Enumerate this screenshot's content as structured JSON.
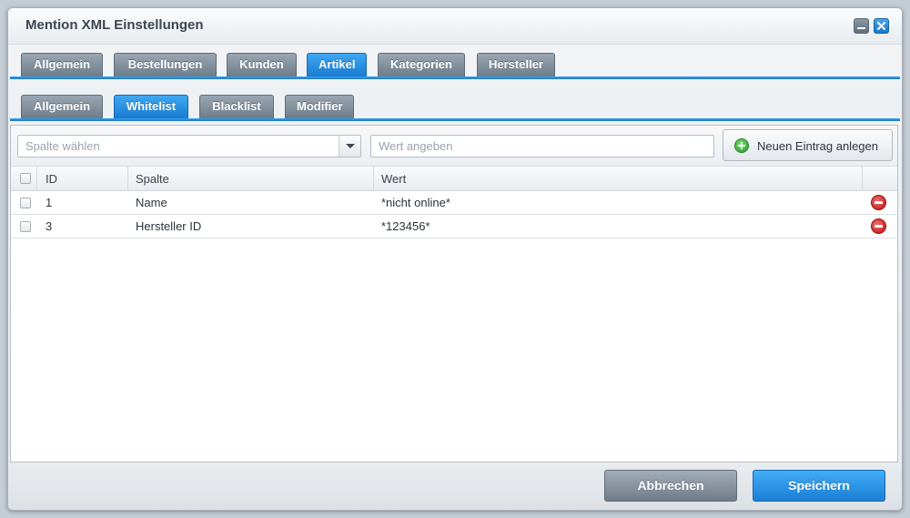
{
  "window": {
    "title": "Mention XML Einstellungen"
  },
  "main_tabs": [
    {
      "label": "Allgemein",
      "active": false
    },
    {
      "label": "Bestellungen",
      "active": false
    },
    {
      "label": "Kunden",
      "active": false
    },
    {
      "label": "Artikel",
      "active": true
    },
    {
      "label": "Kategorien",
      "active": false
    },
    {
      "label": "Hersteller",
      "active": false
    }
  ],
  "sub_tabs": [
    {
      "label": "Allgemein",
      "active": false
    },
    {
      "label": "Whitelist",
      "active": true
    },
    {
      "label": "Blacklist",
      "active": false
    },
    {
      "label": "Modifier",
      "active": false
    }
  ],
  "filter": {
    "column_placeholder": "Spalte wählen",
    "value_placeholder": "Wert angeben",
    "add_button_label": "Neuen Eintrag anlegen"
  },
  "grid": {
    "columns": [
      "ID",
      "Spalte",
      "Wert"
    ],
    "rows": [
      {
        "id": "1",
        "spalte": "Name",
        "wert": "*nicht online*"
      },
      {
        "id": "3",
        "spalte": "Hersteller ID",
        "wert": "*123456*"
      }
    ]
  },
  "footer": {
    "cancel_label": "Abbrechen",
    "save_label": "Speichern"
  },
  "colors": {
    "accent": "#1a7bd0",
    "inactive_tab": "#7d8a97",
    "add_icon": "#2b9a2a",
    "delete_icon": "#b81414"
  },
  "icons": {
    "minimize": "minimize-icon",
    "close": "close-icon",
    "add": "add-icon",
    "delete": "delete-icon",
    "dropdown": "chevron-down-icon"
  }
}
